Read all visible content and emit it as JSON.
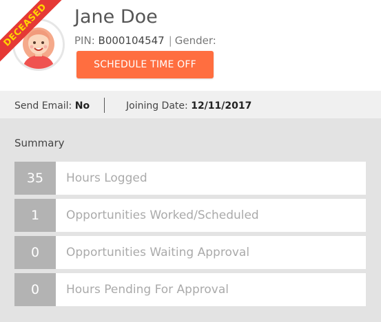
{
  "profile": {
    "name": "Jane Doe",
    "status_ribbon": "DECEASED",
    "pin_label": "PIN:",
    "pin_value": "B000104547",
    "separator": "|",
    "gender_label": "Gender:",
    "schedule_button": "SCHEDULE TIME OFF"
  },
  "info": {
    "send_email_label": "Send Email:",
    "send_email_value": "No",
    "joining_date_label": "Joining Date:",
    "joining_date_value": "12/11/2017"
  },
  "summary": {
    "title": "Summary",
    "items": [
      {
        "value": "35",
        "label": "Hours Logged"
      },
      {
        "value": "1",
        "label": "Opportunities Worked/Scheduled"
      },
      {
        "value": "0",
        "label": "Opportunities Waiting Approval"
      },
      {
        "value": "0",
        "label": "Hours Pending For Approval"
      }
    ]
  },
  "colors": {
    "accent_button": "#ff6e40",
    "ribbon": "#e53935",
    "ribbon_text": "#ffd400"
  },
  "icons": {
    "avatar": "avatar-icon",
    "status": "cross-icon"
  }
}
